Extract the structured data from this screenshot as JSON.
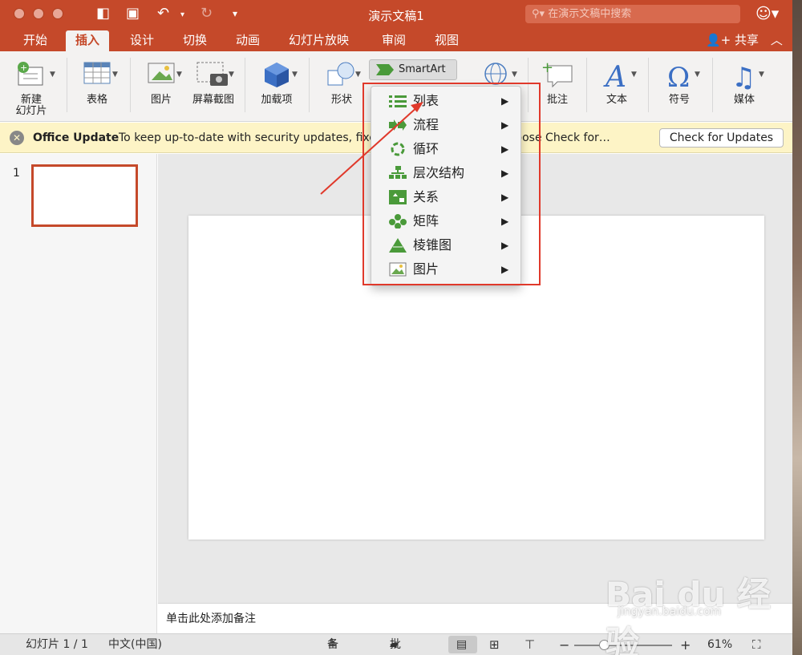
{
  "window": {
    "title": "演示文稿1"
  },
  "search": {
    "placeholder": "在演示文稿中搜索"
  },
  "tabs": [
    "开始",
    "插入",
    "设计",
    "切换",
    "动画",
    "幻灯片放映",
    "审阅",
    "视图"
  ],
  "share_label": "共享",
  "ribbon": {
    "new_slide": "新建\n幻灯片",
    "table": "表格",
    "pictures": "图片",
    "screenshot": "屏幕截图",
    "addins": "加载项",
    "shapes": "形状",
    "smartart": "SmartArt",
    "comment": "批注",
    "text": "文本",
    "symbol": "符号",
    "media": "媒体"
  },
  "infobar": {
    "title": "Office Update",
    "message": "To keep up-to-date with security updates, fixes, and improvements, choose Check for…",
    "button": "Check for Updates"
  },
  "thumbnail": {
    "number": "1"
  },
  "notes_placeholder": "单击此处添加备注",
  "smartart_menu": [
    {
      "label": "列表",
      "icon": "list-icon"
    },
    {
      "label": "流程",
      "icon": "process-icon"
    },
    {
      "label": "循环",
      "icon": "cycle-icon"
    },
    {
      "label": "层次结构",
      "icon": "hierarchy-icon"
    },
    {
      "label": "关系",
      "icon": "relationship-icon"
    },
    {
      "label": "矩阵",
      "icon": "matrix-icon"
    },
    {
      "label": "棱锥图",
      "icon": "pyramid-icon"
    },
    {
      "label": "图片",
      "icon": "picture-icon"
    }
  ],
  "status": {
    "slide_info": "幻灯片 1 / 1",
    "language": "中文(中国)",
    "notes": "备注",
    "comments": "批注",
    "zoom": "61%"
  },
  "watermark": {
    "text": "Bai du 经验",
    "sub": "jingyan.baidu.com"
  },
  "colors": {
    "accent": "#c5492a",
    "highlight": "#e0392b",
    "info_bg": "#fdf4c6"
  }
}
